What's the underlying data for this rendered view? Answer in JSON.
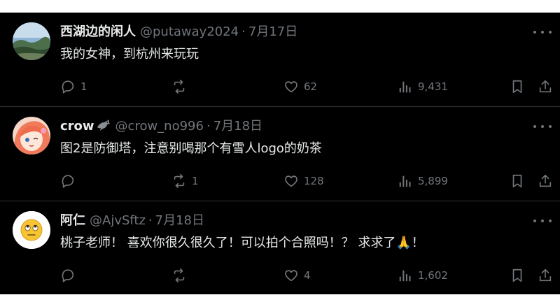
{
  "tweets": [
    {
      "name": "西湖边的闲人",
      "handle": "@putaway2024",
      "date": "7月17日",
      "text": "我的女神，到杭州来玩玩",
      "replies": "1",
      "retweets": "",
      "likes": "62",
      "views": "9,431",
      "avatar_icon": "landscape-photo-avatar"
    },
    {
      "name": "crow",
      "name_icon": "crow-bird-icon",
      "handle": "@crow_no996",
      "date": "7月18日",
      "text": "图2是防御塔，注意别喝那个有雪人logo的奶茶",
      "replies": "",
      "retweets": "1",
      "likes": "128",
      "views": "5,899",
      "avatar_icon": "anime-girl-avatar"
    },
    {
      "name": "阿仁",
      "handle": "@AjvSftz",
      "date": "7月18日",
      "text": "桃子老师！ 喜欢你很久很久了！可以拍个合照吗！？ 求求了🙏！",
      "replies": "",
      "retweets": "",
      "likes": "4",
      "views": "1,602",
      "avatar_icon": "eye-roll-emoji-avatar"
    }
  ],
  "separator": "·",
  "colors": {
    "background": "#000000",
    "text": "#e7e9ea",
    "muted": "#71767b",
    "divider": "#2f3336"
  }
}
